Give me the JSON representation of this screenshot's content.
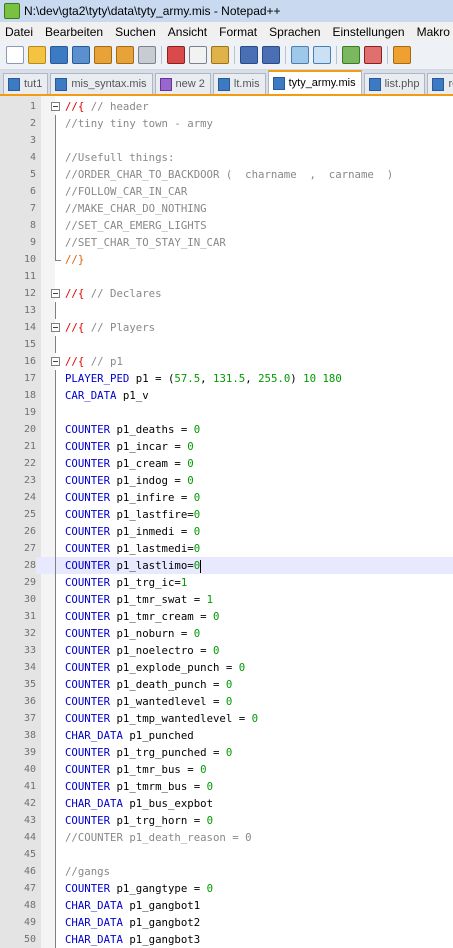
{
  "window": {
    "title": "N:\\dev\\gta2\\tyty\\data\\tyty_army.mis - Notepad++"
  },
  "menu": [
    "Datei",
    "Bearbeiten",
    "Suchen",
    "Ansicht",
    "Format",
    "Sprachen",
    "Einstellungen",
    "Makro"
  ],
  "toolbar": [
    "new-file-icon",
    "open-file-icon",
    "save-icon",
    "save-all-icon",
    "close-icon",
    "close-all-icon",
    "print-icon",
    "cut-icon",
    "copy-icon",
    "paste-icon",
    "undo-icon",
    "redo-icon",
    "find-icon",
    "replace-icon",
    "zoom-in-icon",
    "zoom-out-icon",
    "sync-icon"
  ],
  "tabs": [
    {
      "label": "tut1",
      "active": false
    },
    {
      "label": "mis_syntax.mis",
      "active": false
    },
    {
      "label": "new 2",
      "active": false
    },
    {
      "label": "lt.mis",
      "active": false
    },
    {
      "label": "tyty_army.mis",
      "active": true
    },
    {
      "label": "list.php",
      "active": false
    },
    {
      "label": "re",
      "active": false
    }
  ],
  "editor": {
    "lines": [
      {
        "n": "1",
        "t": "//{ // header"
      },
      {
        "n": "2",
        "t": "//tiny tiny town - army"
      },
      {
        "n": "3",
        "t": ""
      },
      {
        "n": "4",
        "t": "//Usefull things:"
      },
      {
        "n": "5",
        "t": "//ORDER_CHAR_TO_BACKDOOR (  charname  ,  carname  )"
      },
      {
        "n": "6",
        "t": "//FOLLOW_CAR_IN_CAR"
      },
      {
        "n": "7",
        "t": "//MAKE_CHAR_DO_NOTHING"
      },
      {
        "n": "8",
        "t": "//SET_CAR_EMERG_LIGHTS"
      },
      {
        "n": "9",
        "t": "//SET_CHAR_TO_STAY_IN_CAR"
      },
      {
        "n": "10",
        "t": "//}"
      },
      {
        "n": "11",
        "t": ""
      },
      {
        "n": "12",
        "t": "//{ // Declares"
      },
      {
        "n": "13",
        "t": ""
      },
      {
        "n": "14",
        "t": "//{ // Players"
      },
      {
        "n": "15",
        "t": ""
      },
      {
        "n": "16",
        "t": "//{ // p1"
      },
      {
        "n": "17",
        "t": "PLAYER_PED p1 = (57.5, 131.5, 255.0) 10 180"
      },
      {
        "n": "18",
        "t": "CAR_DATA p1_v"
      },
      {
        "n": "19",
        "t": ""
      },
      {
        "n": "20",
        "t": "COUNTER p1_deaths = 0"
      },
      {
        "n": "21",
        "t": "COUNTER p1_incar = 0"
      },
      {
        "n": "22",
        "t": "COUNTER p1_cream = 0"
      },
      {
        "n": "23",
        "t": "COUNTER p1_indog = 0"
      },
      {
        "n": "24",
        "t": "COUNTER p1_infire = 0"
      },
      {
        "n": "25",
        "t": "COUNTER p1_lastfire=0"
      },
      {
        "n": "26",
        "t": "COUNTER p1_inmedi = 0"
      },
      {
        "n": "27",
        "t": "COUNTER p1_lastmedi=0"
      },
      {
        "n": "28",
        "t": "COUNTER p1_lastlimo=0"
      },
      {
        "n": "29",
        "t": "COUNTER p1_trg_ic=1"
      },
      {
        "n": "30",
        "t": "COUNTER p1_tmr_swat = 1"
      },
      {
        "n": "31",
        "t": "COUNTER p1_tmr_cream = 0"
      },
      {
        "n": "32",
        "t": "COUNTER p1_noburn = 0"
      },
      {
        "n": "33",
        "t": "COUNTER p1_noelectro = 0"
      },
      {
        "n": "34",
        "t": "COUNTER p1_explode_punch = 0"
      },
      {
        "n": "35",
        "t": "COUNTER p1_death_punch = 0"
      },
      {
        "n": "36",
        "t": "COUNTER p1_wantedlevel = 0"
      },
      {
        "n": "37",
        "t": "COUNTER p1_tmp_wantedlevel = 0"
      },
      {
        "n": "38",
        "t": "CHAR_DATA p1_punched"
      },
      {
        "n": "39",
        "t": "COUNTER p1_trg_punched = 0"
      },
      {
        "n": "40",
        "t": "COUNTER p1_tmr_bus = 0"
      },
      {
        "n": "41",
        "t": "COUNTER p1_tmrm_bus = 0"
      },
      {
        "n": "42",
        "t": "CHAR_DATA p1_bus_expbot"
      },
      {
        "n": "43",
        "t": "COUNTER p1_trg_horn = 0"
      },
      {
        "n": "44",
        "t": "//COUNTER p1_death_reason = 0"
      },
      {
        "n": "45",
        "t": ""
      },
      {
        "n": "46",
        "t": "//gangs"
      },
      {
        "n": "47",
        "t": "COUNTER p1_gangtype = 0"
      },
      {
        "n": "48",
        "t": "CHAR_DATA p1_gangbot1"
      },
      {
        "n": "49",
        "t": "CHAR_DATA p1_gangbot2"
      },
      {
        "n": "50",
        "t": "CHAR_DATA p1_gangbot3"
      }
    ]
  }
}
